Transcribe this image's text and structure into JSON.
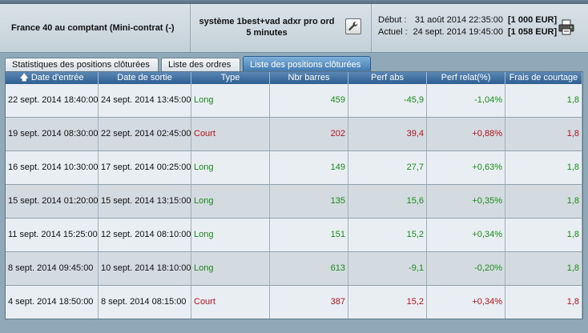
{
  "header": {
    "instrument": "France 40 au comptant (Mini-contrat  (-)",
    "system_name": "système 1best+vad adxr pro ord",
    "timeframe": "5 minutes",
    "start_label": "Début :",
    "start_date": "31 août 2014 22:35:00",
    "start_capital": "[1 000 EUR]",
    "current_label": "Actuel :",
    "current_date": "24 sept. 2014 19:45:00",
    "current_capital": "[1 058 EUR]"
  },
  "tabs": [
    {
      "label": "Statistiques des positions clôturées",
      "active": false
    },
    {
      "label": "Liste des ordres",
      "active": false
    },
    {
      "label": "Liste des positions clôturées",
      "active": true
    }
  ],
  "table": {
    "columns": [
      "Date d'entrée",
      "Date de sortie",
      "Type",
      "Nbr barres",
      "Perf abs",
      "Perf relat(%)",
      "Frais de courtage"
    ],
    "sort_icon": "sort-up-icon",
    "rows": [
      {
        "entry": "22 sept. 2014 18:40:00",
        "exit": "24 sept. 2014 13:45:00",
        "type": "Long",
        "bars": "459",
        "perf_abs": "-45,9",
        "perf_rel": "-1,04%",
        "fees": "1,8"
      },
      {
        "entry": "19 sept. 2014 08:30:00",
        "exit": "22 sept. 2014 02:45:00",
        "type": "Court",
        "bars": "202",
        "perf_abs": "39,4",
        "perf_rel": "+0,88%",
        "fees": "1,8"
      },
      {
        "entry": "16 sept. 2014 10:30:00",
        "exit": "17 sept. 2014 00:25:00",
        "type": "Long",
        "bars": "149",
        "perf_abs": "27,7",
        "perf_rel": "+0,63%",
        "fees": "1,8"
      },
      {
        "entry": "15 sept. 2014 01:20:00",
        "exit": "15 sept. 2014 13:15:00",
        "type": "Long",
        "bars": "135",
        "perf_abs": "15,6",
        "perf_rel": "+0,35%",
        "fees": "1,8"
      },
      {
        "entry": "11 sept. 2014 15:25:00",
        "exit": "12 sept. 2014 08:10:00",
        "type": "Long",
        "bars": "151",
        "perf_abs": "15,2",
        "perf_rel": "+0,34%",
        "fees": "1,8"
      },
      {
        "entry": "8 sept. 2014 09:45:00",
        "exit": "10 sept. 2014 18:10:00",
        "type": "Long",
        "bars": "613",
        "perf_abs": "-9,1",
        "perf_rel": "-0,20%",
        "fees": "1,8"
      },
      {
        "entry": "4 sept. 2014 18:50:00",
        "exit": "8 sept. 2014 08:15:00",
        "type": "Court",
        "bars": "387",
        "perf_abs": "15,2",
        "perf_rel": "+0,34%",
        "fees": "1,8"
      }
    ]
  },
  "colors": {
    "long": "#1b8a1b",
    "short": "#b0141c",
    "header_blue": "#2e5f91",
    "active_tab": "#3f78ad"
  },
  "icons": {
    "settings": "wrench-icon",
    "print": "printer-icon"
  }
}
